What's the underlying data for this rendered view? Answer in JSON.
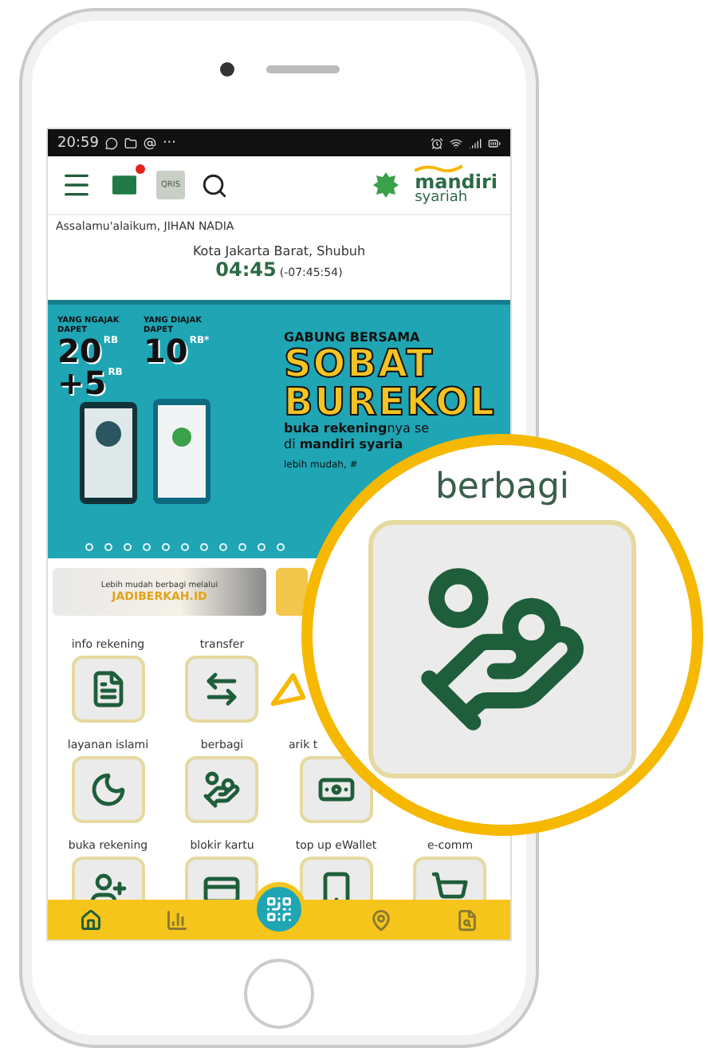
{
  "status_bar": {
    "time": "20:59",
    "more": "···"
  },
  "header": {
    "mail_unread": true,
    "qr_label": "QRIS",
    "logo": "mandiri",
    "logo_sub": "syariah"
  },
  "greeting": "Assalamu'alaikum, JIHAN NADIA",
  "prayer": {
    "place": "Kota Jakarta Barat, Shubuh",
    "time": "04:45",
    "countdown": "(-07:45:54)"
  },
  "banner": {
    "inviter_label": "YANG NGAJAK DAPET",
    "inviter_amount": "20",
    "inviter_unit": "RB",
    "inviter_bonus": "+5",
    "inviter_bonus_unit": "RB",
    "invitee_label": "YANG DIAJAK DAPET",
    "invitee_amount": "10",
    "invitee_unit": "RB*",
    "kicker": "GABUNG BERSAMA",
    "title_1": "SOBAT",
    "title_2": "BUREKOL",
    "line_1": "**buka rekening**nya se",
    "line_2": "di **mandiri syaria**",
    "line_3": "lebih mudah, #"
  },
  "promo": {
    "text": "Lebih mudah berbagi melalui",
    "site": "JADIBERKAH.ID"
  },
  "menu": [
    {
      "kind": "info",
      "label": "info rekening"
    },
    {
      "kind": "transfer",
      "label": "transfer"
    },
    {
      "kind": "hidden"
    },
    {
      "kind": "hidden"
    },
    {
      "kind": "islami",
      "label": "layanan islami"
    },
    {
      "kind": "share",
      "label": "berbagi"
    },
    {
      "kind": "cash",
      "label": "arik t"
    },
    {
      "kind": "hidden"
    },
    {
      "kind": "account",
      "label": "buka rekening"
    },
    {
      "kind": "card",
      "label": "blokir kartu"
    },
    {
      "kind": "wallet",
      "label": "top up eWallet"
    },
    {
      "kind": "shop",
      "label": "e-comm"
    }
  ],
  "bottom_nav": [
    {
      "kind": "home",
      "selected": true
    },
    {
      "kind": "chart",
      "selected": false
    },
    {
      "kind": "qr",
      "selected": false
    },
    {
      "kind": "map",
      "selected": false
    },
    {
      "kind": "doc",
      "selected": false
    }
  ],
  "callout": {
    "label": "berbagi"
  }
}
